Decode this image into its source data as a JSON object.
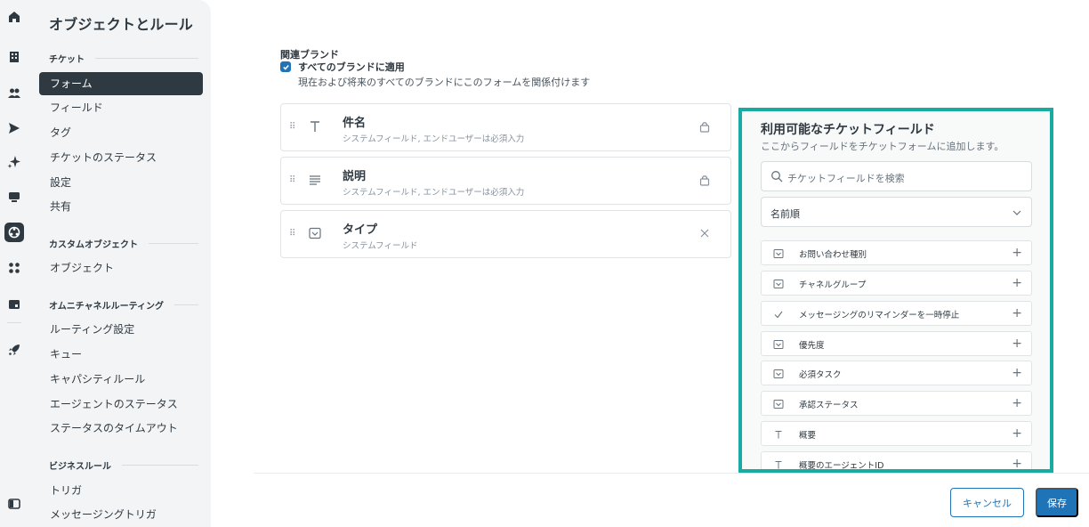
{
  "nav": {
    "title": "オブジェクトとルール",
    "sections": [
      {
        "label": "チケット",
        "items": [
          "フォーム",
          "フィールド",
          "タグ",
          "チケットのステータス",
          "設定",
          "共有"
        ]
      },
      {
        "label": "カスタムオブジェクト",
        "items": [
          "オブジェクト"
        ]
      },
      {
        "label": "オムニチャネルルーティング",
        "items": [
          "ルーティング設定",
          "キュー",
          "キャパシティルール",
          "エージェントのステータス",
          "ステータスのタイムアウト"
        ]
      },
      {
        "label": "ビジネスルール",
        "items": [
          "トリガ",
          "メッセージングトリガ"
        ]
      }
    ],
    "active_item": "フォーム"
  },
  "rail": {
    "icons": [
      "home-icon",
      "building-icon",
      "users-icon",
      "send-icon",
      "sparkle-icon",
      "chat-icon",
      "objects-rules-icon",
      "apps-icon",
      "workspace-icon",
      "rocket-icon",
      "sidebar-toggle-icon"
    ]
  },
  "brand": {
    "label": "関連ブランド",
    "checkbox_label": "すべてのブランドに適用",
    "checkbox_checked": true,
    "hint": "現在および将来のすべてのブランドにこのフォームを関係付けます"
  },
  "form_fields": [
    {
      "name": "件名",
      "desc": "システムフィールド, エンドユーザーは必須入力",
      "icon": "text-icon",
      "right_icon": "lock-icon"
    },
    {
      "name": "説明",
      "desc": "システムフィールド, エンドユーザーは必須入力",
      "icon": "paragraph-icon",
      "right_icon": "lock-icon"
    },
    {
      "name": "タイプ",
      "desc": "システムフィールド",
      "icon": "dropdown-icon",
      "right_icon": "close-icon"
    }
  ],
  "available": {
    "title": "利用可能なチケットフィールド",
    "hint": "ここからフィールドをチケットフォームに追加します。",
    "search_placeholder": "チケットフィールドを検索",
    "sort_label": "名前順",
    "items": [
      {
        "label": "お問い合わせ種別",
        "icon": "dropdown-icon"
      },
      {
        "label": "チャネルグループ",
        "icon": "dropdown-icon"
      },
      {
        "label": "メッセージングのリマインダーを一時停止",
        "icon": "check-icon"
      },
      {
        "label": "優先度",
        "icon": "dropdown-icon"
      },
      {
        "label": "必須タスク",
        "icon": "dropdown-icon"
      },
      {
        "label": "承認ステータス",
        "icon": "dropdown-icon"
      },
      {
        "label": "概要",
        "icon": "text-icon"
      },
      {
        "label": "概要のエージェントID",
        "icon": "text-icon"
      }
    ]
  },
  "footer": {
    "cancel_label": "キャンセル",
    "save_label": "保存"
  },
  "colors": {
    "accent": "#1f73b7",
    "highlight_border": "#17aba2",
    "nav_bg": "#f3f4f5",
    "active_nav": "#2f3941"
  }
}
